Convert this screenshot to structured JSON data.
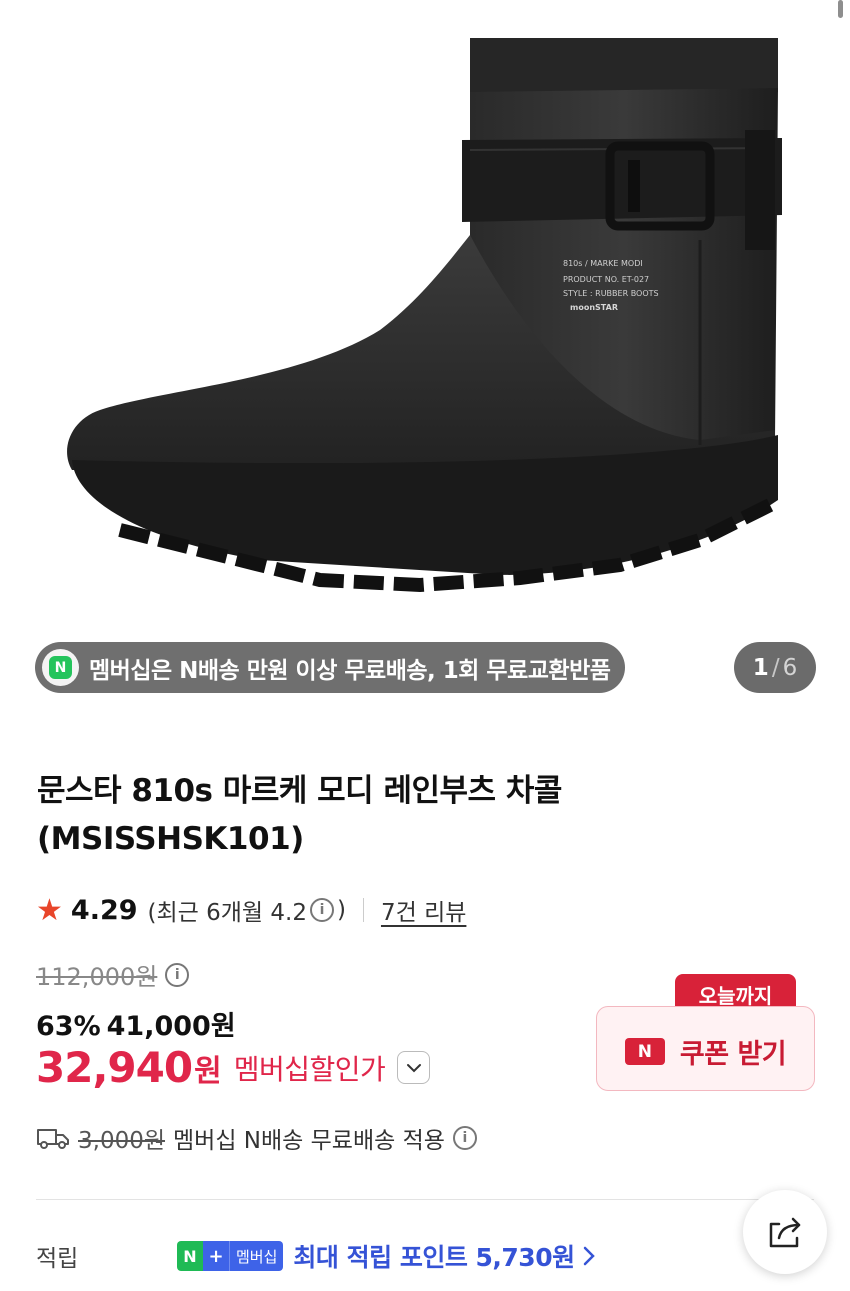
{
  "image": {
    "boot_print": {
      "line1": "810s / MARKE MODI",
      "line2": "PRODUCT NO. ET-027",
      "line3": "STYLE : RUBBER BOOTS",
      "brand": "moonSTAR"
    }
  },
  "promo": {
    "logo_letter": "N",
    "text": "멤버십은 N배송 만원 이상 무료배송, 1회 무료교환반품"
  },
  "pager": {
    "current": "1",
    "separator": "/",
    "total": "6"
  },
  "product": {
    "title": "문스타 810s 마르케 모디 레인부츠 차콜 (MSISSHSK101)"
  },
  "rating": {
    "star": "★",
    "score": "4.29",
    "recent_prefix": "(최근 6개월 4.2",
    "recent_suffix": ")",
    "info": "i",
    "reviews": "7건 리뷰"
  },
  "price": {
    "original": "112,000원",
    "discount": "63%",
    "sale": "41,000원",
    "member_price": "32,940",
    "member_unit": "원",
    "member_label": "멤버십할인가"
  },
  "coupon": {
    "tag": "오늘까지",
    "logo_letter": "N",
    "label": "쿠폰 받기"
  },
  "shipping": {
    "fee": "3,000원",
    "text": "멤버십 N배송 무료배송 적용"
  },
  "points": {
    "key": "적립",
    "badge_n": "N",
    "badge_plus": "+",
    "badge_label": "멤버십",
    "value": "최대 적립 포인트 5,730원"
  },
  "colors": {
    "member_red": "#e0264a",
    "coupon_red": "#d82239",
    "point_blue": "#3553d6",
    "star": "#e8452a"
  },
  "icons": {
    "star": "star-icon",
    "info": "info-icon",
    "chevron": "chevron-down-icon",
    "truck": "truck-icon",
    "share": "share-icon"
  }
}
